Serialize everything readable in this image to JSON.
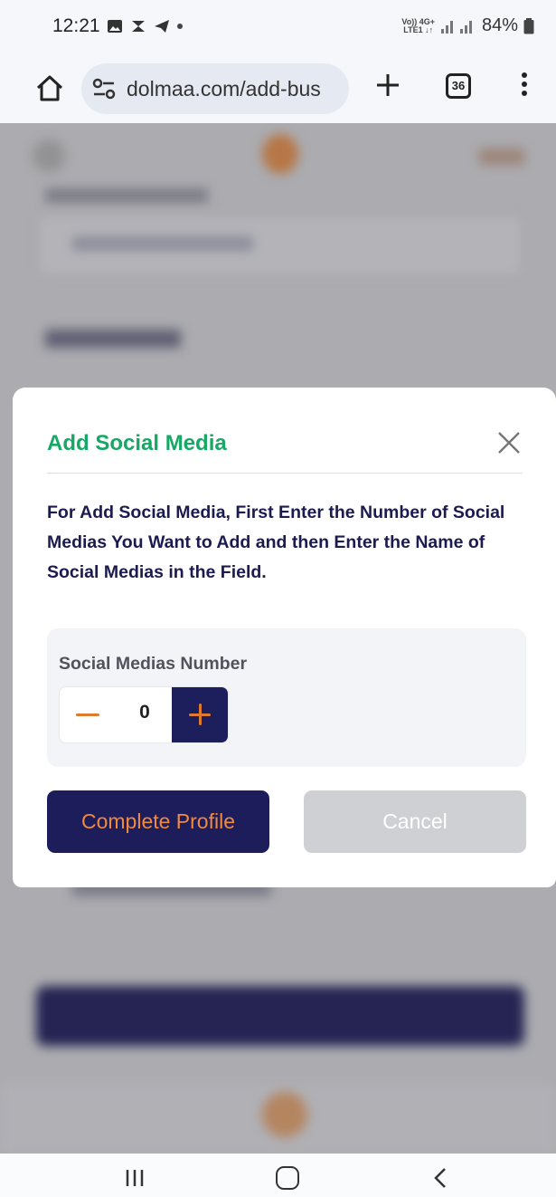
{
  "status_bar": {
    "time": "12:21",
    "network_top": "Vo)) 4G+",
    "network_bottom": "LTE1 ↓↑",
    "battery": "84%"
  },
  "browser": {
    "url": "dolmaa.com/add-bus",
    "tab_count": "36"
  },
  "modal": {
    "title": "Add Social Media",
    "description": "For Add Social Media, First Enter the Number of Social Medias You Want to Add and then Enter the Name of Social Medias in the Field.",
    "stepper_label": "Social Medias Number",
    "stepper_value": "0",
    "complete_button": "Complete Profile",
    "cancel_button": "Cancel"
  },
  "colors": {
    "title": "#17a866",
    "navy": "#1e1d5b",
    "orange": "#f08a3c",
    "cancel": "#cfd0d3"
  }
}
